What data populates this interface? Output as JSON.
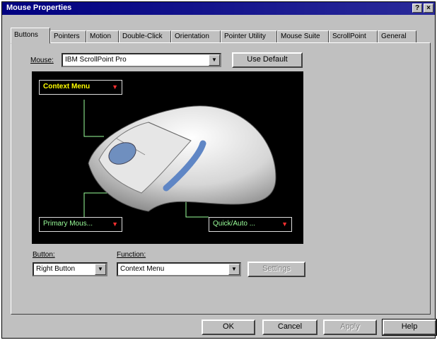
{
  "window": {
    "title": "Mouse Properties",
    "help_glyph": "?",
    "close_glyph": "×"
  },
  "tabs": [
    "Buttons",
    "Pointers",
    "Motion",
    "Double-Click",
    "Orientation",
    "Pointer Utility",
    "Mouse Suite",
    "ScrollPoint",
    "General"
  ],
  "mouse": {
    "label": "Mouse:",
    "value": "IBM ScrollPoint Pro",
    "use_default_label": "Use Default"
  },
  "preview": {
    "context_menu": "Context Menu",
    "primary": "Primary Mous...",
    "quick": "Quick/Auto ...",
    "arrow": "▼"
  },
  "button_field": {
    "label": "Button:",
    "value": "Right Button"
  },
  "function_field": {
    "label": "Function:",
    "value": "Context Menu"
  },
  "settings_label": "Settings",
  "footer": {
    "ok": "OK",
    "cancel": "Cancel",
    "apply": "Apply",
    "help": "Help"
  },
  "colors": {
    "title_bar": "#000080",
    "context_menu_text": "#ffff00",
    "label_text": "#9aff9a",
    "arrow_red": "#ff3030"
  }
}
